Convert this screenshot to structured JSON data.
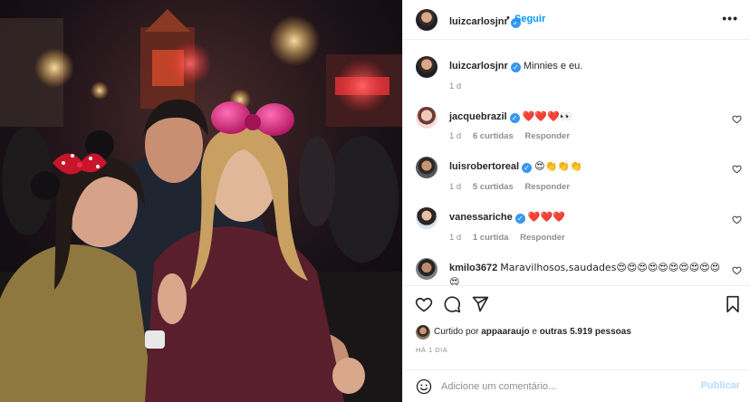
{
  "photo": {
    "alt_icon": "photo"
  },
  "post": {
    "author": "luizcarlosjnr",
    "verified": true,
    "follow_label": "Seguir",
    "separator": "•",
    "more_icon": "more-horizontal-icon",
    "caption": "Minnies e eu.",
    "caption_time": "1 d"
  },
  "comments": [
    {
      "user": "jacquebrazil",
      "verified": true,
      "text": "❤️❤️❤️👀",
      "time": "1 d",
      "likes": "6 curtidas",
      "reply": "Responder"
    },
    {
      "user": "luisrobertoreal",
      "verified": true,
      "text": "😍👏👏👏",
      "time": "1 d",
      "likes": "5 curtidas",
      "reply": "Responder"
    },
    {
      "user": "vanessariche",
      "verified": true,
      "text": "❤️❤️❤️",
      "time": "1 d",
      "likes": "1 curtida",
      "reply": "Responder"
    },
    {
      "user": "kmilo3672",
      "verified": false,
      "text": "Maravilhosos,saudades😍😍😍😍😍😍😍😍😍😍😍",
      "time": "",
      "likes": "",
      "reply": ""
    }
  ],
  "actions": {
    "like_icon": "heart-icon",
    "comment_icon": "comment-icon",
    "share_icon": "send-icon",
    "save_icon": "bookmark-icon"
  },
  "likes": {
    "prefix": "Curtido por",
    "user": "appaaraujo",
    "conj": "e",
    "others": "outras 5.919 pessoas"
  },
  "time_ago": "HÁ 1 DIA",
  "composer": {
    "placeholder": "Adicione um comentário...",
    "post_label": "Publicar",
    "emoji_icon": "emoji-icon"
  },
  "colors": {
    "link": "#0095f6",
    "verified": "#3897f0",
    "post_disabled": "#b3dbff",
    "heart": "#ed4956"
  }
}
